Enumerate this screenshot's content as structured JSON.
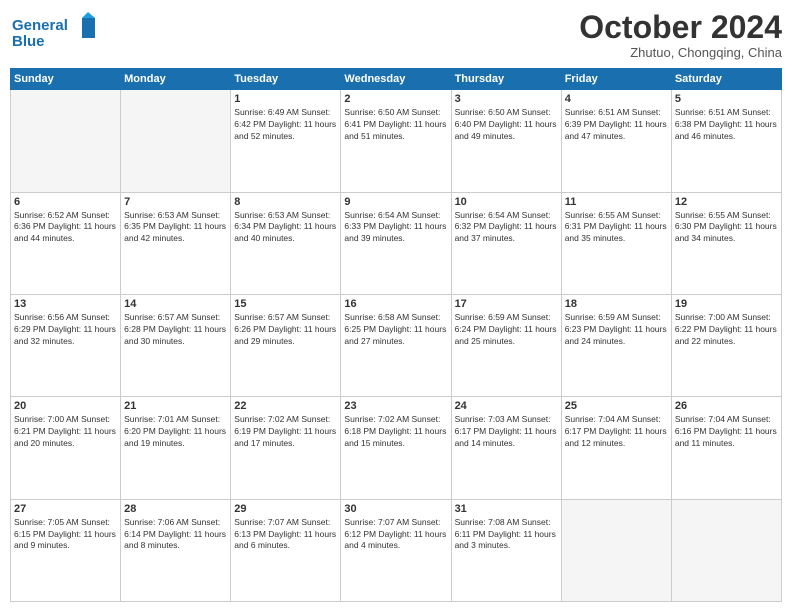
{
  "header": {
    "logo_line1": "General",
    "logo_line2": "Blue",
    "month": "October 2024",
    "location": "Zhutuo, Chongqing, China"
  },
  "days_of_week": [
    "Sunday",
    "Monday",
    "Tuesday",
    "Wednesday",
    "Thursday",
    "Friday",
    "Saturday"
  ],
  "weeks": [
    [
      {
        "day": "",
        "info": ""
      },
      {
        "day": "",
        "info": ""
      },
      {
        "day": "1",
        "info": "Sunrise: 6:49 AM\nSunset: 6:42 PM\nDaylight: 11 hours\nand 52 minutes."
      },
      {
        "day": "2",
        "info": "Sunrise: 6:50 AM\nSunset: 6:41 PM\nDaylight: 11 hours\nand 51 minutes."
      },
      {
        "day": "3",
        "info": "Sunrise: 6:50 AM\nSunset: 6:40 PM\nDaylight: 11 hours\nand 49 minutes."
      },
      {
        "day": "4",
        "info": "Sunrise: 6:51 AM\nSunset: 6:39 PM\nDaylight: 11 hours\nand 47 minutes."
      },
      {
        "day": "5",
        "info": "Sunrise: 6:51 AM\nSunset: 6:38 PM\nDaylight: 11 hours\nand 46 minutes."
      }
    ],
    [
      {
        "day": "6",
        "info": "Sunrise: 6:52 AM\nSunset: 6:36 PM\nDaylight: 11 hours\nand 44 minutes."
      },
      {
        "day": "7",
        "info": "Sunrise: 6:53 AM\nSunset: 6:35 PM\nDaylight: 11 hours\nand 42 minutes."
      },
      {
        "day": "8",
        "info": "Sunrise: 6:53 AM\nSunset: 6:34 PM\nDaylight: 11 hours\nand 40 minutes."
      },
      {
        "day": "9",
        "info": "Sunrise: 6:54 AM\nSunset: 6:33 PM\nDaylight: 11 hours\nand 39 minutes."
      },
      {
        "day": "10",
        "info": "Sunrise: 6:54 AM\nSunset: 6:32 PM\nDaylight: 11 hours\nand 37 minutes."
      },
      {
        "day": "11",
        "info": "Sunrise: 6:55 AM\nSunset: 6:31 PM\nDaylight: 11 hours\nand 35 minutes."
      },
      {
        "day": "12",
        "info": "Sunrise: 6:55 AM\nSunset: 6:30 PM\nDaylight: 11 hours\nand 34 minutes."
      }
    ],
    [
      {
        "day": "13",
        "info": "Sunrise: 6:56 AM\nSunset: 6:29 PM\nDaylight: 11 hours\nand 32 minutes."
      },
      {
        "day": "14",
        "info": "Sunrise: 6:57 AM\nSunset: 6:28 PM\nDaylight: 11 hours\nand 30 minutes."
      },
      {
        "day": "15",
        "info": "Sunrise: 6:57 AM\nSunset: 6:26 PM\nDaylight: 11 hours\nand 29 minutes."
      },
      {
        "day": "16",
        "info": "Sunrise: 6:58 AM\nSunset: 6:25 PM\nDaylight: 11 hours\nand 27 minutes."
      },
      {
        "day": "17",
        "info": "Sunrise: 6:59 AM\nSunset: 6:24 PM\nDaylight: 11 hours\nand 25 minutes."
      },
      {
        "day": "18",
        "info": "Sunrise: 6:59 AM\nSunset: 6:23 PM\nDaylight: 11 hours\nand 24 minutes."
      },
      {
        "day": "19",
        "info": "Sunrise: 7:00 AM\nSunset: 6:22 PM\nDaylight: 11 hours\nand 22 minutes."
      }
    ],
    [
      {
        "day": "20",
        "info": "Sunrise: 7:00 AM\nSunset: 6:21 PM\nDaylight: 11 hours\nand 20 minutes."
      },
      {
        "day": "21",
        "info": "Sunrise: 7:01 AM\nSunset: 6:20 PM\nDaylight: 11 hours\nand 19 minutes."
      },
      {
        "day": "22",
        "info": "Sunrise: 7:02 AM\nSunset: 6:19 PM\nDaylight: 11 hours\nand 17 minutes."
      },
      {
        "day": "23",
        "info": "Sunrise: 7:02 AM\nSunset: 6:18 PM\nDaylight: 11 hours\nand 15 minutes."
      },
      {
        "day": "24",
        "info": "Sunrise: 7:03 AM\nSunset: 6:17 PM\nDaylight: 11 hours\nand 14 minutes."
      },
      {
        "day": "25",
        "info": "Sunrise: 7:04 AM\nSunset: 6:17 PM\nDaylight: 11 hours\nand 12 minutes."
      },
      {
        "day": "26",
        "info": "Sunrise: 7:04 AM\nSunset: 6:16 PM\nDaylight: 11 hours\nand 11 minutes."
      }
    ],
    [
      {
        "day": "27",
        "info": "Sunrise: 7:05 AM\nSunset: 6:15 PM\nDaylight: 11 hours\nand 9 minutes."
      },
      {
        "day": "28",
        "info": "Sunrise: 7:06 AM\nSunset: 6:14 PM\nDaylight: 11 hours\nand 8 minutes."
      },
      {
        "day": "29",
        "info": "Sunrise: 7:07 AM\nSunset: 6:13 PM\nDaylight: 11 hours\nand 6 minutes."
      },
      {
        "day": "30",
        "info": "Sunrise: 7:07 AM\nSunset: 6:12 PM\nDaylight: 11 hours\nand 4 minutes."
      },
      {
        "day": "31",
        "info": "Sunrise: 7:08 AM\nSunset: 6:11 PM\nDaylight: 11 hours\nand 3 minutes."
      },
      {
        "day": "",
        "info": ""
      },
      {
        "day": "",
        "info": ""
      }
    ]
  ]
}
